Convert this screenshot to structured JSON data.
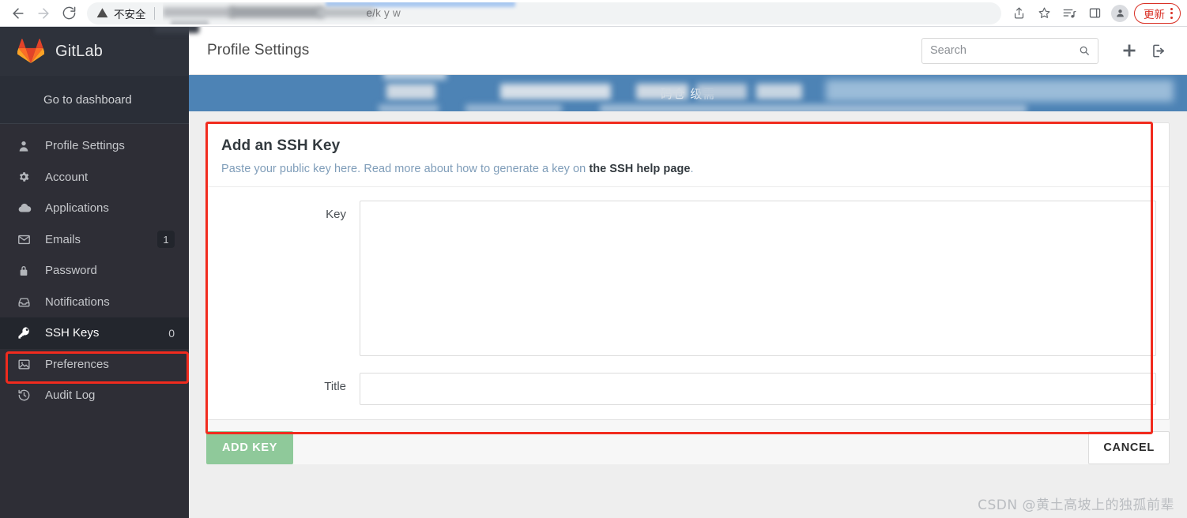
{
  "browser": {
    "back_icon": "back-arrow-icon",
    "forward_icon": "forward-arrow-icon",
    "reload_icon": "reload-icon",
    "security_warning": "不安全",
    "url_visible_fragment": "e/k   y   w",
    "reading_list_icon": "reading-list-icon",
    "bookmark_icon": "star-icon",
    "side_panel_icon": "side-panel-icon",
    "profile_icon": "profile-avatar-icon",
    "update_label": "更新",
    "menu_icon": "kebab-menu-icon",
    "accent_red": "#d93025"
  },
  "sidebar": {
    "brand": "GitLab",
    "brand_logo": "gitlab-tanuki-logo",
    "dashboard_link": "Go to dashboard",
    "bg": "#2e2e36",
    "active_bg": "#23262d",
    "items": [
      {
        "label": "Profile Settings",
        "icon": "user-icon",
        "count": "",
        "active": false
      },
      {
        "label": "Account",
        "icon": "gear-icon",
        "count": "",
        "active": false
      },
      {
        "label": "Applications",
        "icon": "cloud-icon",
        "count": "",
        "active": false
      },
      {
        "label": "Emails",
        "icon": "envelope-icon",
        "count": "1",
        "active": false
      },
      {
        "label": "Password",
        "icon": "lock-icon",
        "count": "",
        "active": false
      },
      {
        "label": "Notifications",
        "icon": "inbox-icon",
        "count": "",
        "active": false
      },
      {
        "label": "SSH Keys",
        "icon": "key-icon",
        "count": "0",
        "active": true
      },
      {
        "label": "Preferences",
        "icon": "image-icon",
        "count": "",
        "active": false
      },
      {
        "label": "Audit Log",
        "icon": "history-icon",
        "count": "",
        "active": false
      }
    ]
  },
  "header": {
    "title": "Profile Settings",
    "search_placeholder": "Search",
    "search_value": "",
    "search_icon": "magnifier-icon",
    "new_icon": "plus-icon",
    "signout_icon": "sign-out-icon"
  },
  "notice": {
    "text": "码仓                级需",
    "bg": "#4d83b5"
  },
  "panel": {
    "title": "Add an SSH Key",
    "description_prefix": "Paste your public key here. Read more about how to generate a key on ",
    "description_link": "the SSH help page",
    "description_suffix": ".",
    "key_label": "Key",
    "key_value": "",
    "key_placeholder": "",
    "title_label": "Title",
    "title_value": "",
    "title_placeholder": "",
    "resize_handle_icon": "resize-grip-icon",
    "highlight_color": "#f12b1e"
  },
  "actions": {
    "add_key_label": "ADD KEY",
    "add_key_color": "#8fc99a",
    "cancel_label": "CANCEL"
  },
  "watermark": {
    "text": "CSDN @黄土高坡上的独孤前辈"
  }
}
